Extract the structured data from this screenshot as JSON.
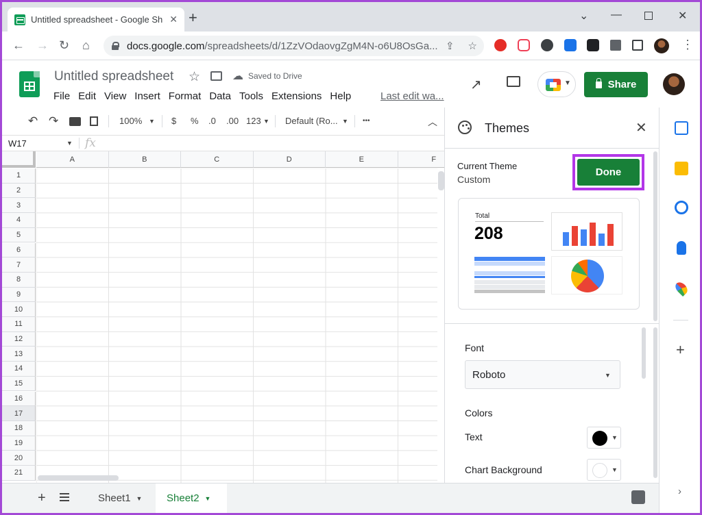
{
  "browser": {
    "tab_title": "Untitled spreadsheet - Google Sh",
    "new_tab": "+",
    "url_host": "docs.google.com",
    "url_path": "/spreadsheets/d/1ZzVOdaovgZgM4N-o6U8OsGa..."
  },
  "app": {
    "doc_title": "Untitled spreadsheet",
    "save_status": "Saved to Drive",
    "menu": [
      "File",
      "Edit",
      "View",
      "Insert",
      "Format",
      "Data",
      "Tools",
      "Extensions",
      "Help"
    ],
    "last_edit": "Last edit wa...",
    "share_label": "Share"
  },
  "toolbar": {
    "zoom": "100%",
    "currency": "$",
    "percent": "%",
    "decrease_decimal": ".0",
    "increase_decimal": ".00",
    "more_formats": "123",
    "font": "Default (Ro...",
    "more": "•••"
  },
  "formula_bar": {
    "cell_ref": "W17",
    "fx": "fx"
  },
  "grid": {
    "columns": [
      "A",
      "B",
      "C",
      "D",
      "E",
      "F"
    ],
    "rows": [
      "1",
      "2",
      "3",
      "4",
      "5",
      "6",
      "7",
      "8",
      "9",
      "10",
      "11",
      "12",
      "13",
      "14",
      "15",
      "16",
      "17",
      "18",
      "19",
      "20",
      "21"
    ],
    "selected_row": "17"
  },
  "sheets": {
    "tabs": [
      {
        "label": "Sheet1",
        "active": false
      },
      {
        "label": "Sheet2",
        "active": true
      }
    ]
  },
  "themes_panel": {
    "title": "Themes",
    "current_theme_label": "Current Theme",
    "current_theme_value": "Custom",
    "done_label": "Done",
    "preview": {
      "total_label": "Total",
      "total_value": "208",
      "bar_colors": [
        "#4285f4",
        "#ea4335",
        "#4285f4",
        "#ea4335",
        "#4285f4",
        "#ea4335"
      ],
      "pie_colors": [
        "#4285f4",
        "#ea4335",
        "#fbbc04",
        "#34a853",
        "#ff6d01"
      ]
    },
    "font_label": "Font",
    "font_value": "Roboto",
    "colors_label": "Colors",
    "text_color_label": "Text",
    "text_color": "#000000",
    "chart_bg_label": "Chart Background",
    "chart_bg_color": "#ffffff"
  },
  "colors": {
    "accent_green": "#188038",
    "highlight_purple": "#b336e8"
  }
}
